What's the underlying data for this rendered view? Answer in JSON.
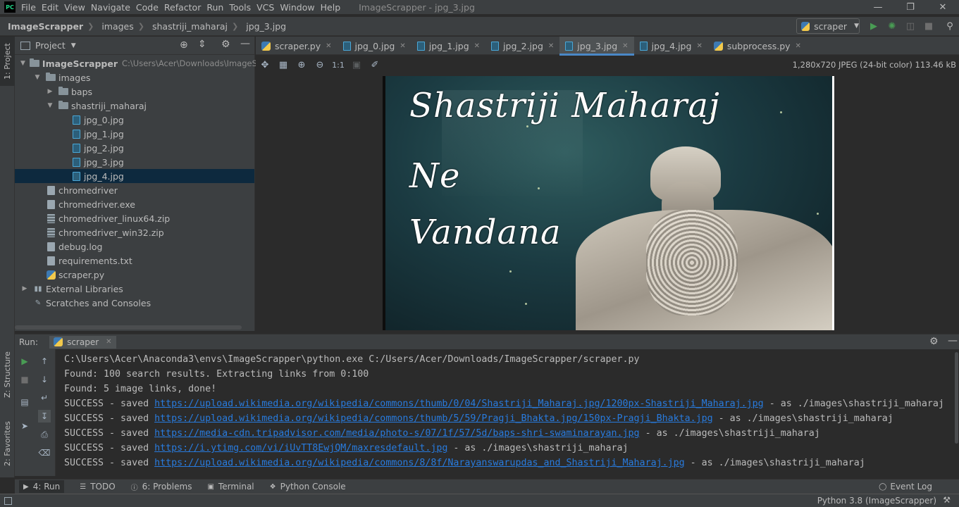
{
  "menubar": {
    "logo": "PC",
    "items": [
      "File",
      "Edit",
      "View",
      "Navigate",
      "Code",
      "Refactor",
      "Run",
      "Tools",
      "VCS",
      "Window",
      "Help"
    ],
    "title": "ImageScrapper - jpg_3.jpg"
  },
  "navbar": {
    "breadcrumbs": [
      "ImageScrapper",
      "images",
      "shastriji_maharaj",
      "jpg_3.jpg"
    ],
    "run_config": "scraper"
  },
  "left_strip": {
    "project_tab": "1: Project",
    "structure_tab": "Z: Structure",
    "favorites_tab": "2: Favorites"
  },
  "project": {
    "header": "Project",
    "root": "ImageScrapper",
    "root_path": "C:\\Users\\Acer\\Downloads\\ImageScrapp",
    "tree": [
      {
        "label": "images",
        "indent": 1,
        "type": "folder",
        "expanded": true
      },
      {
        "label": "baps",
        "indent": 2,
        "type": "folder",
        "expanded": false
      },
      {
        "label": "shastriji_maharaj",
        "indent": 2,
        "type": "folder",
        "expanded": true
      },
      {
        "label": "jpg_0.jpg",
        "indent": 3,
        "type": "image"
      },
      {
        "label": "jpg_1.jpg",
        "indent": 3,
        "type": "image"
      },
      {
        "label": "jpg_2.jpg",
        "indent": 3,
        "type": "image"
      },
      {
        "label": "jpg_3.jpg",
        "indent": 3,
        "type": "image"
      },
      {
        "label": "jpg_4.jpg",
        "indent": 3,
        "type": "image",
        "selected": true
      },
      {
        "label": "chromedriver",
        "indent": 1,
        "type": "file"
      },
      {
        "label": "chromedriver.exe",
        "indent": 1,
        "type": "file"
      },
      {
        "label": "chromedriver_linux64.zip",
        "indent": 1,
        "type": "zip"
      },
      {
        "label": "chromedriver_win32.zip",
        "indent": 1,
        "type": "zip"
      },
      {
        "label": "debug.log",
        "indent": 1,
        "type": "file"
      },
      {
        "label": "requirements.txt",
        "indent": 1,
        "type": "file"
      },
      {
        "label": "scraper.py",
        "indent": 1,
        "type": "python"
      }
    ],
    "external_libraries": "External Libraries",
    "scratches": "Scratches and Consoles"
  },
  "editor": {
    "tabs": [
      {
        "label": "scraper.py",
        "icon": "python-icon",
        "active": false
      },
      {
        "label": "jpg_0.jpg",
        "icon": "image-icon",
        "active": false
      },
      {
        "label": "jpg_1.jpg",
        "icon": "image-icon",
        "active": false
      },
      {
        "label": "jpg_2.jpg",
        "icon": "image-icon",
        "active": false
      },
      {
        "label": "jpg_3.jpg",
        "icon": "image-icon",
        "active": true
      },
      {
        "label": "jpg_4.jpg",
        "icon": "image-icon",
        "active": false
      },
      {
        "label": "subprocess.py",
        "icon": "python-icon",
        "active": false
      }
    ],
    "image_info": "1,280x720 JPEG (24-bit color) 113.46 kB",
    "zoom_actual": "1:1",
    "image_text": [
      "Shastriji Maharaj",
      "Ne",
      "Vandana"
    ]
  },
  "run": {
    "label": "Run:",
    "tab": "scraper",
    "lines": [
      {
        "text": "C:\\Users\\Acer\\Anaconda3\\envs\\ImageScrapper\\python.exe C:/Users/Acer/Downloads/ImageScrapper/scraper.py"
      },
      {
        "text": "Found: 100 search results. Extracting links from 0:100"
      },
      {
        "text": "Found: 5 image links, done!"
      },
      {
        "prefix": "SUCCESS - saved ",
        "link": "https://upload.wikimedia.org/wikipedia/commons/thumb/0/04/Shastriji_Maharaj.jpg/1200px-Shastriji_Maharaj.jpg",
        "suffix": " - as ./images\\shastriji_maharaj"
      },
      {
        "prefix": "SUCCESS - saved ",
        "link": "https://upload.wikimedia.org/wikipedia/commons/thumb/5/59/Pragji_Bhakta.jpg/150px-Pragji_Bhakta.jpg",
        "suffix": " - as ./images\\shastriji_maharaj"
      },
      {
        "prefix": "SUCCESS - saved ",
        "link": "https://media-cdn.tripadvisor.com/media/photo-s/07/1f/57/5d/baps-shri-swaminarayan.jpg",
        "suffix": " - as ./images\\shastriji_maharaj"
      },
      {
        "prefix": "SUCCESS - saved ",
        "link": "https://i.ytimg.com/vi/iUvTT8EwjQM/maxresdefault.jpg",
        "suffix": " - as ./images\\shastriji_maharaj"
      },
      {
        "prefix": "SUCCESS - saved ",
        "link": "https://upload.wikimedia.org/wikipedia/commons/8/8f/Narayanswarupdas_and_Shastriji_Maharaj.jpg",
        "suffix": " - as ./images\\shastriji_maharaj"
      }
    ]
  },
  "bottom_tabs": [
    {
      "label": "4: Run",
      "icon": "run-icon",
      "active": true
    },
    {
      "label": "TODO",
      "icon": "list-icon",
      "active": false
    },
    {
      "label": "6: Problems",
      "icon": "problems-icon",
      "active": false
    },
    {
      "label": "Terminal",
      "icon": "terminal-icon",
      "active": false
    },
    {
      "label": "Python Console",
      "icon": "python-console-icon",
      "active": false
    }
  ],
  "event_log": "Event Log",
  "status": {
    "interpreter": "Python 3.8 (ImageScrapper)"
  },
  "colors": {
    "accent": "#4a88c7",
    "link": "#287bde",
    "run_green": "#499c54",
    "selection": "#0d293e"
  }
}
